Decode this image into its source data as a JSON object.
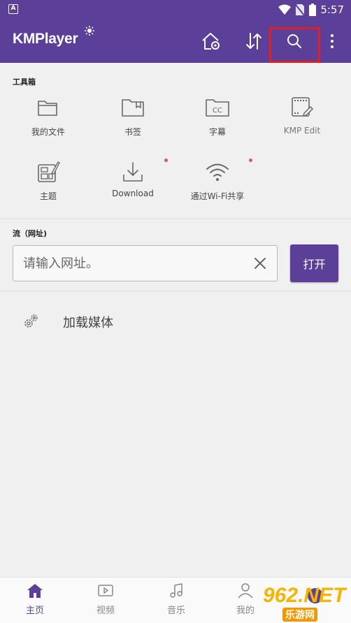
{
  "status_bar": {
    "time": "5:57",
    "left_icon_letter": "A"
  },
  "app": {
    "logo": "KMPlayer",
    "brand_color": "#5b3f98"
  },
  "toolbox": {
    "label": "工具箱",
    "items": [
      {
        "label": "我的文件",
        "icon": "folder-icon"
      },
      {
        "label": "书签",
        "icon": "bookmark-folder-icon"
      },
      {
        "label": "字幕",
        "icon": "subtitle-cc-folder-icon"
      },
      {
        "label": "KMP Edit",
        "icon": "film-edit-icon"
      },
      {
        "label": "主题",
        "icon": "theme-palette-icon"
      },
      {
        "label": "Download",
        "icon": "download-icon"
      },
      {
        "label": "通过Wi-Fi共享",
        "icon": "wifi-icon"
      }
    ]
  },
  "stream": {
    "label": "流（网址)",
    "placeholder": "请输入网址。",
    "open_label": "打开"
  },
  "load_media": {
    "label": "加载媒体"
  },
  "bottom_nav": {
    "items": [
      {
        "label": "主页",
        "icon": "home-icon",
        "active": true
      },
      {
        "label": "视频",
        "icon": "video-icon"
      },
      {
        "label": "音乐",
        "icon": "music-note-icon"
      },
      {
        "label": "我的",
        "icon": "profile-icon"
      }
    ]
  },
  "watermark": {
    "line1": "962.NET",
    "line2": "乐游网"
  }
}
